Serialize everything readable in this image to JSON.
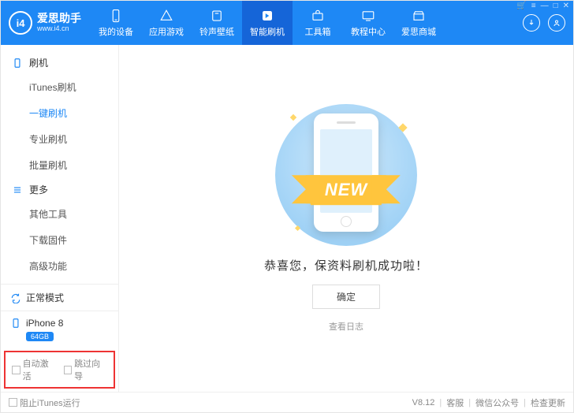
{
  "brand": {
    "name": "爱思助手",
    "url": "www.i4.cn",
    "logo_text": "i4"
  },
  "nav": [
    {
      "label": "我的设备",
      "icon": "device"
    },
    {
      "label": "应用游戏",
      "icon": "apps"
    },
    {
      "label": "铃声壁纸",
      "icon": "music"
    },
    {
      "label": "智能刷机",
      "icon": "flash",
      "active": true
    },
    {
      "label": "工具箱",
      "icon": "toolbox"
    },
    {
      "label": "教程中心",
      "icon": "tutorial"
    },
    {
      "label": "爱思商城",
      "icon": "store"
    }
  ],
  "sidebar": {
    "section1": "刷机",
    "items1": [
      "iTunes刷机",
      "一键刷机",
      "专业刷机",
      "批量刷机"
    ],
    "active1": 1,
    "section2": "更多",
    "items2": [
      "其他工具",
      "下载固件",
      "高级功能"
    ],
    "status": "正常模式",
    "device": {
      "name": "iPhone 8",
      "storage": "64GB"
    },
    "checks": {
      "auto_activate": "自动激活",
      "skip_guide": "跳过向导"
    }
  },
  "main": {
    "ribbon": "NEW",
    "message": "恭喜您，保资料刷机成功啦！",
    "ok": "确定",
    "log": "查看日志"
  },
  "footer": {
    "block_itunes": "阻止iTunes运行",
    "version": "V8.12",
    "support": "客服",
    "wechat": "微信公众号",
    "update": "检查更新"
  }
}
